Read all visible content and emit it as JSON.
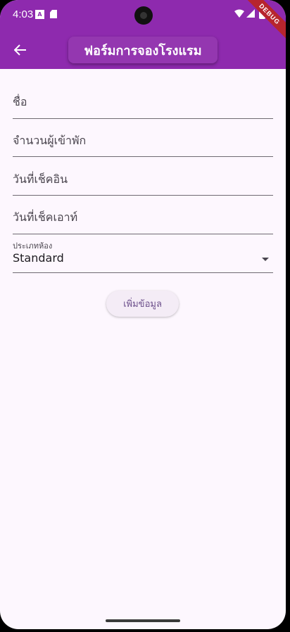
{
  "status_bar": {
    "time": "4:03",
    "notification_letter": "A"
  },
  "debug_banner": "DEBUG",
  "app_bar": {
    "title": "ฟอร์มการจองโรงแรม",
    "back_icon": "arrow-back-icon"
  },
  "form": {
    "name_placeholder": "ชื่อ",
    "guests_placeholder": "จำนวนผู้เข้าพัก",
    "checkin_placeholder": "วันที่เช็คอิน",
    "checkout_placeholder": "วันที่เช็คเอาท์",
    "room_type": {
      "label": "ประเภทห้อง",
      "value": "Standard"
    },
    "submit_label": "เพิ่มข้อมูล"
  },
  "colors": {
    "app_bar": "#8e2aae",
    "background": "#fdf7fe",
    "debug": "#b7252d"
  }
}
